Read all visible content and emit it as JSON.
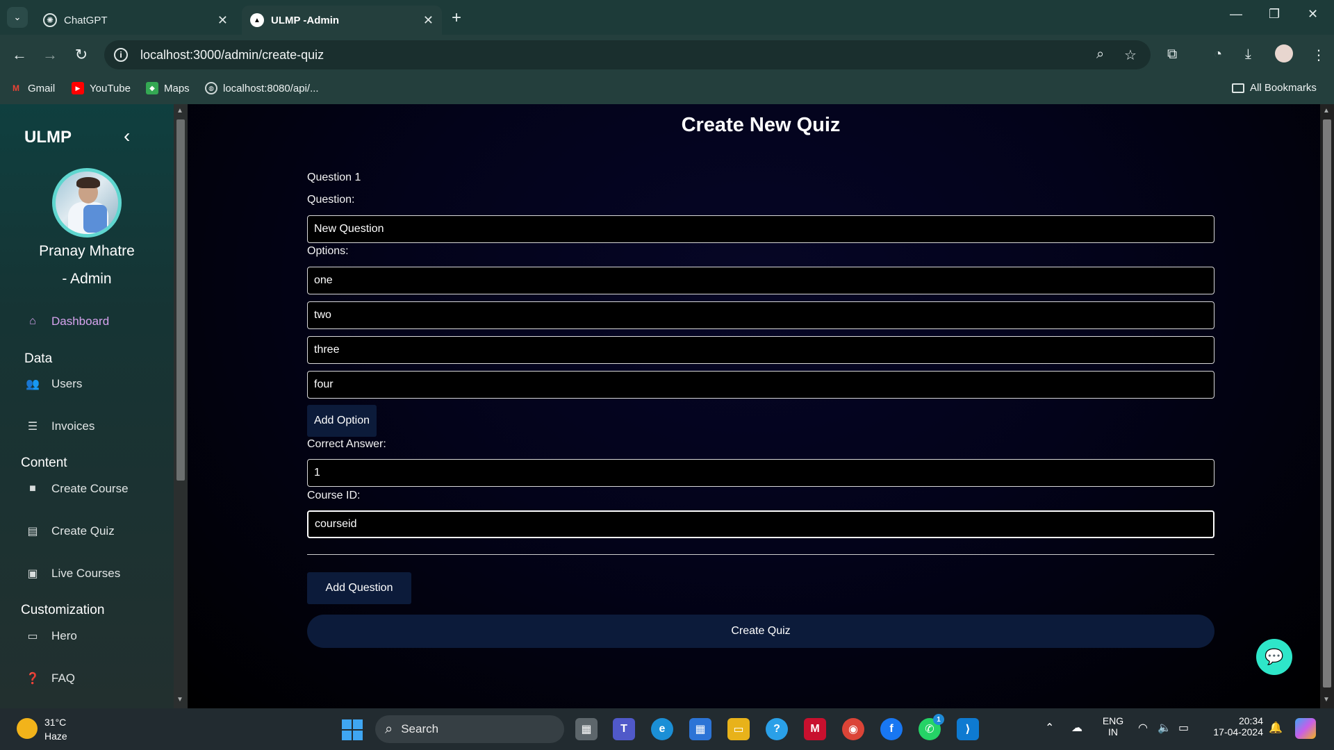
{
  "browser": {
    "tabs": [
      {
        "title": "ChatGPT",
        "active": false
      },
      {
        "title": "ULMP -Admin",
        "active": true
      }
    ],
    "url": "localhost:3000/admin/create-quiz",
    "bookmarks": [
      "Gmail",
      "YouTube",
      "Maps",
      "localhost:8080/api/..."
    ],
    "all_bookmarks": "All Bookmarks"
  },
  "sidebar": {
    "brand": "ULMP",
    "user_name": "Pranay Mhatre",
    "user_role": "- Admin",
    "dashboard": "Dashboard",
    "sections": {
      "data": "Data",
      "content": "Content",
      "customization": "Customization"
    },
    "items": {
      "users": "Users",
      "invoices": "Invoices",
      "create_course": "Create Course",
      "create_quiz": "Create Quiz",
      "live_courses": "Live Courses",
      "hero": "Hero",
      "faq": "FAQ"
    }
  },
  "main": {
    "title": "Create New Quiz",
    "question_heading": "Question 1",
    "question_label": "Question:",
    "question_value": "New Question",
    "options_label": "Options:",
    "options": [
      "one",
      "two",
      "three",
      "four"
    ],
    "add_option": "Add Option",
    "correct_answer_label": "Correct Answer:",
    "correct_answer_value": "1",
    "course_id_label": "Course ID:",
    "course_id_value": "courseid",
    "add_question": "Add Question",
    "create_quiz": "Create Quiz"
  },
  "taskbar": {
    "weather_temp": "31°C",
    "weather_desc": "Haze",
    "search_placeholder": "Search",
    "lang_line1": "ENG",
    "lang_line2": "IN",
    "time": "20:34",
    "date": "17-04-2024",
    "whatsapp_badge": "1"
  },
  "colors": {
    "accent_teal": "#2ee6c9",
    "button_navy": "#0c1b3a",
    "sidebar_active": "#d6a3ee"
  }
}
